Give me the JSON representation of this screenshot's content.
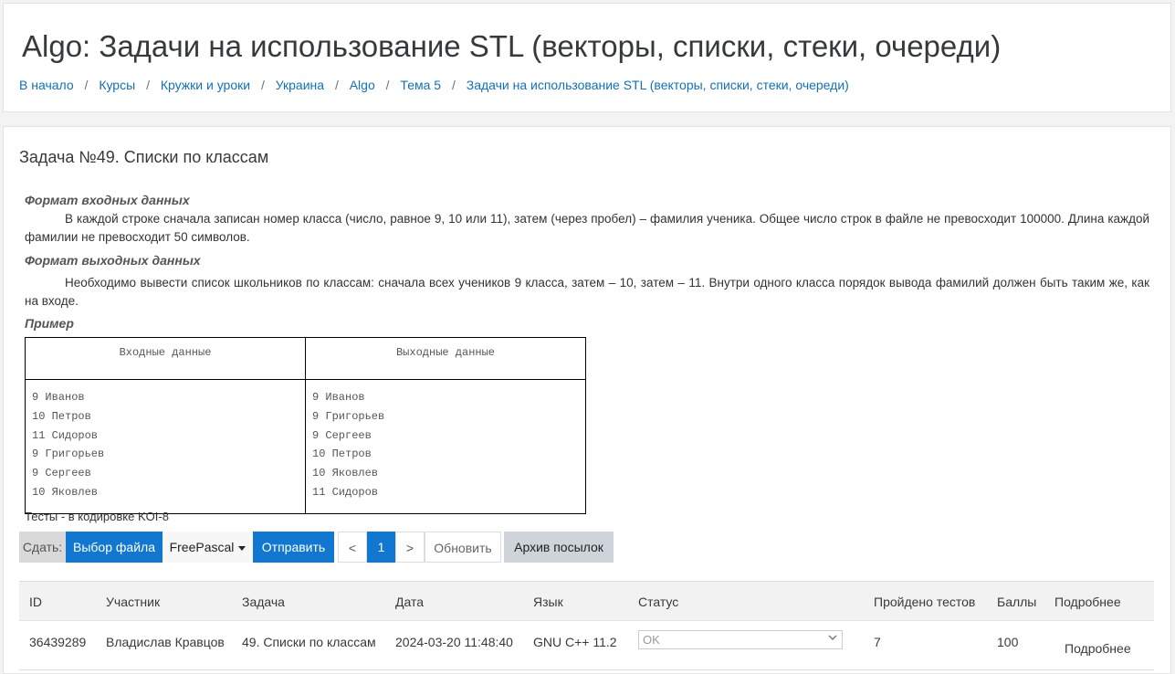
{
  "header": {
    "title": "Algo: Задачи на использование STL (векторы, списки, стеки, очереди)",
    "breadcrumb": [
      "В начало",
      "Курсы",
      "Кружки и уроки",
      "Украина",
      "Algo",
      "Тема 5",
      "Задачи на использование STL (векторы, списки, стеки, очереди)"
    ],
    "separator": "/"
  },
  "task": {
    "title": "Задача №49. Списки по классам",
    "input_heading": "Формат входных данных",
    "input_text": "В каждой строке сначала записан номер класса (число, равное 9, 10 или 11), затем (через пробел) – фамилия ученика. Общее число строк в файле не превосходит 100000. Длина каждой фамилии не превосходит 50 символов.",
    "output_heading": "Формат выходных данных",
    "output_text": "Необходимо вывести список школьников по классам: сначала всех учеников 9 класса, затем – 10, затем – 11. Внутри одного класса порядок вывода фамилий должен быть таким же, как на входе.",
    "example_heading": "Пример",
    "example": {
      "input_header": "Входные данные",
      "output_header": "Выходные данные",
      "input_lines": [
        "9 Иванов",
        "10 Петров",
        "11 Сидоров",
        "9 Григорьев",
        "9 Сергеев",
        "10 Яковлев"
      ],
      "output_lines": [
        "9 Иванов",
        "9 Григорьев",
        "9 Сергеев",
        "10 Петров",
        "10 Яковлев",
        "11 Сидоров"
      ]
    },
    "tests_note": "Тесты - в кодировке KOI-8"
  },
  "toolbar": {
    "submit_label": "Сдать:",
    "choose_file": "Выбор файла",
    "language": "FreePascal",
    "send": "Отправить",
    "prev": "<",
    "page": "1",
    "next": ">",
    "refresh": "Обновить",
    "archive": "Архив посылок"
  },
  "submissions": {
    "columns": [
      "ID",
      "Участник",
      "Задача",
      "Дата",
      "Язык",
      "Статус",
      "Пройдено тестов",
      "Баллы",
      "Подробнее"
    ],
    "rows": [
      {
        "id": "36439289",
        "participant": "Владислав Кравцов",
        "problem": "49. Списки по классам",
        "date": "2024-03-20 11:48:40",
        "language": "GNU C++ 11.2",
        "status": "OK",
        "tests_passed": "7",
        "score": "100",
        "details": "Подробнее"
      }
    ]
  },
  "colors": {
    "primary": "#1177d1",
    "link": "#1170c1",
    "archive_button": "#ced4da"
  },
  "icons": [
    "caret-down-icon",
    "chevron-down-icon"
  ]
}
